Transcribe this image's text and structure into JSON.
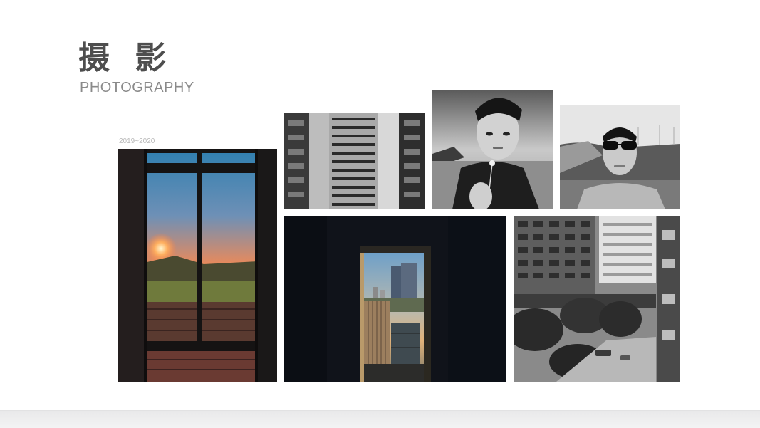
{
  "header": {
    "title_cn": "摄 影",
    "title_en": "PHOTOGRAPHY"
  },
  "gallery": {
    "date_range": "2019~2020",
    "photos": [
      {
        "subject": "sunset-window",
        "style": "color"
      },
      {
        "subject": "apartment-building",
        "style": "bw"
      },
      {
        "subject": "portrait-dandelion",
        "style": "bw"
      },
      {
        "subject": "portrait-sunglasses",
        "style": "bw"
      },
      {
        "subject": "doorway-city-view",
        "style": "color"
      },
      {
        "subject": "street-buildings",
        "style": "bw"
      }
    ]
  },
  "colors": {
    "title": "#4e4e4e",
    "subtitle": "#8a8a8a",
    "date": "#b9b9b9",
    "background": "#ffffff"
  }
}
